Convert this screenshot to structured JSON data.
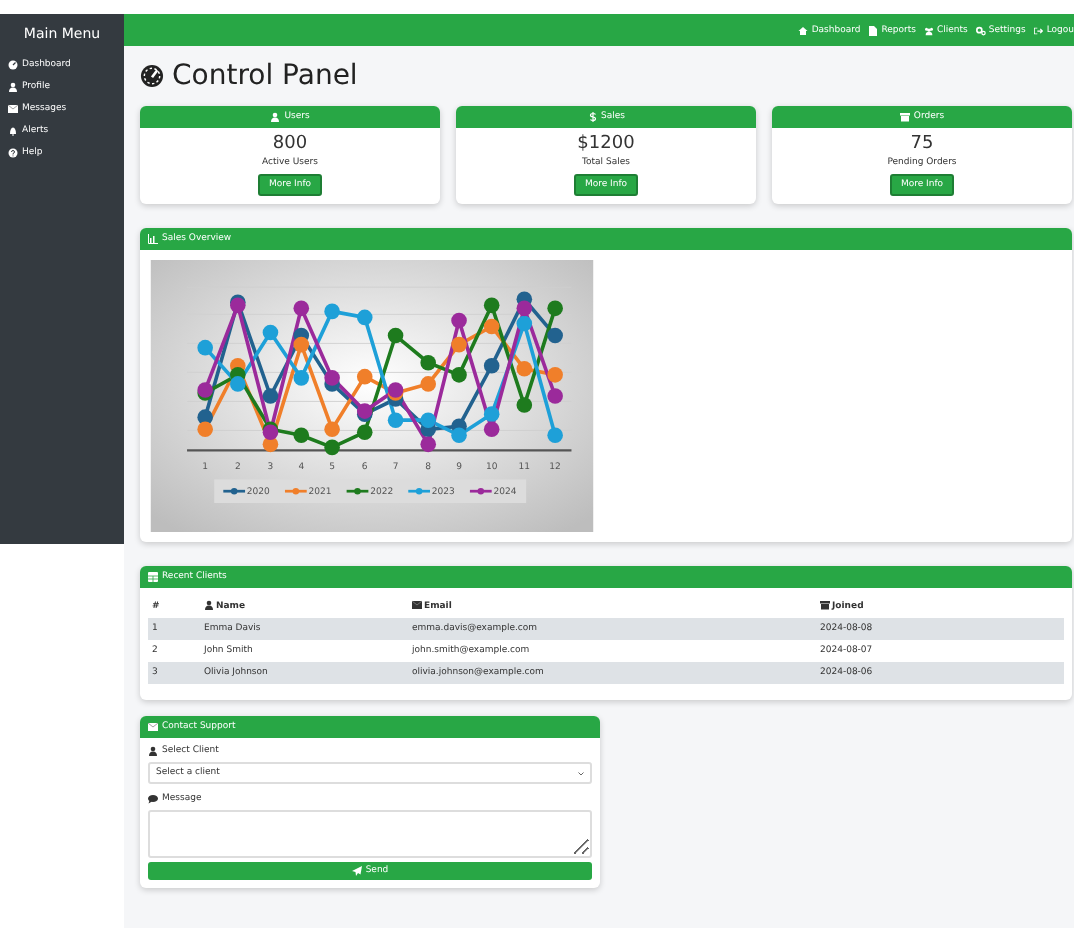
{
  "sidebar": {
    "title": "Main Menu",
    "items": [
      {
        "label": "Dashboard"
      },
      {
        "label": "Profile"
      },
      {
        "label": "Messages"
      },
      {
        "label": "Alerts"
      },
      {
        "label": "Help"
      }
    ]
  },
  "top_nav": {
    "items": [
      {
        "label": "Dashboard"
      },
      {
        "label": "Reports"
      },
      {
        "label": "Clients"
      },
      {
        "label": "Settings"
      },
      {
        "label": "Logou"
      }
    ]
  },
  "page_title": "Control Panel",
  "stat_cards": [
    {
      "header": "Users",
      "value": "800",
      "caption": "Active Users",
      "button": "More Info"
    },
    {
      "header": "Sales",
      "value": "$1200",
      "caption": "Total Sales",
      "button": "More Info"
    },
    {
      "header": "Orders",
      "value": "75",
      "caption": "Pending Orders",
      "button": "More Info"
    }
  ],
  "sales_overview": {
    "header": "Sales Overview",
    "axis_labels": [
      "1",
      "2",
      "3",
      "4",
      "5",
      "6",
      "7",
      "8",
      "9",
      "10",
      "11",
      "12"
    ],
    "legend": [
      {
        "name": "2020",
        "color": "#22628f"
      },
      {
        "name": "2021",
        "color": "#f07f2a"
      },
      {
        "name": "2022",
        "color": "#1e7b1e"
      },
      {
        "name": "2023",
        "color": "#1ea0d8"
      },
      {
        "name": "2024",
        "color": "#9b2a9b"
      }
    ]
  },
  "recent_clients": {
    "header": "Recent Clients",
    "columns": [
      "#",
      "Name",
      "Email",
      "Joined"
    ],
    "rows": [
      [
        "1",
        "Emma Davis",
        "emma.davis@example.com",
        "2024-08-08"
      ],
      [
        "2",
        "John Smith",
        "john.smith@example.com",
        "2024-08-07"
      ],
      [
        "3",
        "Olivia Johnson",
        "olivia.johnson@example.com",
        "2024-08-06"
      ]
    ]
  },
  "contact_support": {
    "header": "Contact Support",
    "client_label": "Select Client",
    "client_placeholder": "Select a client",
    "message_label": "Message",
    "button": "Send"
  }
}
